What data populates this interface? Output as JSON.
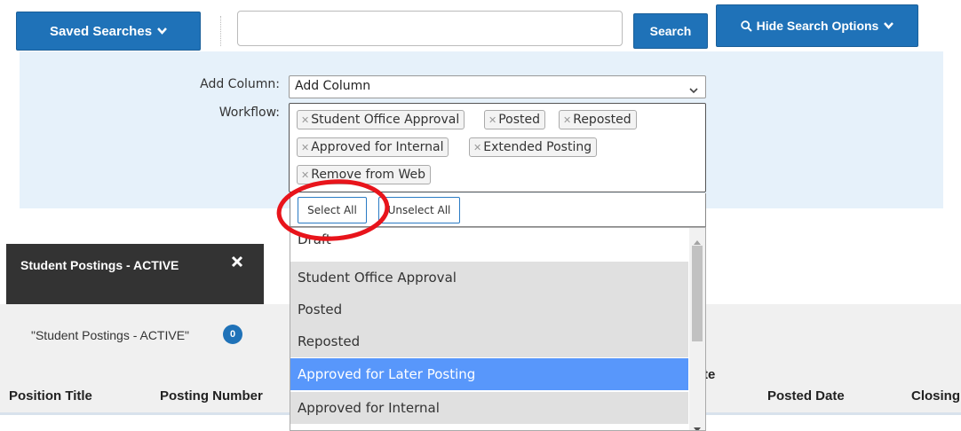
{
  "toolbar": {
    "saved_searches_label": "Saved Searches",
    "search_placeholder": "",
    "search_button_label": "Search",
    "hide_options_label": "Hide Search Options"
  },
  "options": {
    "add_column_label": "Add Column:",
    "add_column_value": "Add Column",
    "workflow_label": "Workflow:",
    "workflow_tags": [
      "Student Office Approval",
      "Posted",
      "Reposted",
      "Approved for Internal",
      "Extended Posting",
      "Remove from Web"
    ],
    "select_all_label": "Select All",
    "unselect_all_label": "Unselect All"
  },
  "dropdown": {
    "options": [
      "Draft",
      "Student Office Approval",
      "Posted",
      "Reposted",
      "Approved for Later Posting",
      "Approved for Internal"
    ],
    "highlighted": "Approved for Later Posting"
  },
  "tab": {
    "label": "Student Postings - ACTIVE"
  },
  "results": {
    "title": "\"Student Postings - ACTIVE\"",
    "count": "0"
  },
  "table": {
    "headers": [
      "Position Title",
      "Posting Number",
      "te",
      "Posted Date",
      "Closing"
    ]
  },
  "colors": {
    "primary": "#1f72b8",
    "panel_bg": "#e6f1fa",
    "highlight": "#5897fb",
    "annotation": "#e8141b"
  }
}
